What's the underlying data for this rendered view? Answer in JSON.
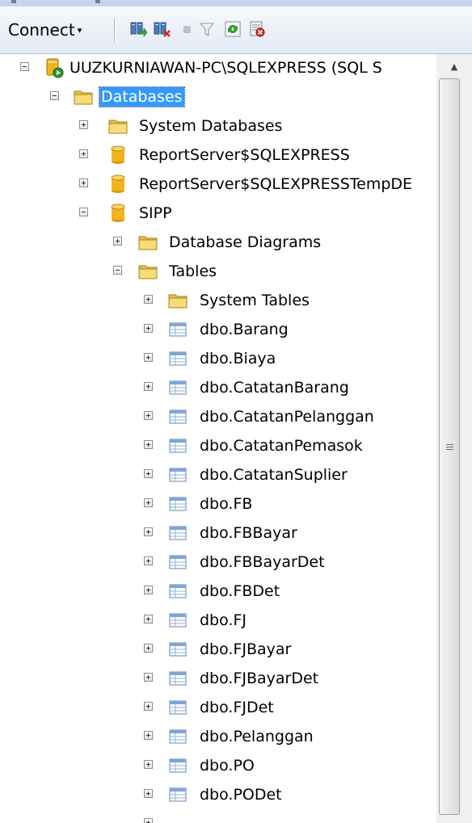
{
  "toolbar": {
    "connect_label": "Connect",
    "connect_arrow": "▾",
    "icons": [
      "register-server-icon",
      "disconnect-icon",
      "stop-icon",
      "filter-icon",
      "refresh-icon",
      "activity-monitor-icon"
    ]
  },
  "tree": {
    "server": "UUZKURNIAWAN-PC\\SQLEXPRESS (SQL S",
    "databases": "Databases",
    "system_databases": "System Databases",
    "db_reportserver": "ReportServer$SQLEXPRESS",
    "db_reportserver_temp": "ReportServer$SQLEXPRESSTempDE",
    "db_sipp": "SIPP",
    "database_diagrams": "Database Diagrams",
    "tables": "Tables",
    "system_tables": "System Tables",
    "table_items": [
      "dbo.Barang",
      "dbo.Biaya",
      "dbo.CatatanBarang",
      "dbo.CatatanPelanggan",
      "dbo.CatatanPemasok",
      "dbo.CatatanSuplier",
      "dbo.FB",
      "dbo.FBBayar",
      "dbo.FBBayarDet",
      "dbo.FBDet",
      "dbo.FJ",
      "dbo.FJBayar",
      "dbo.FJBayarDet",
      "dbo.FJDet",
      "dbo.Pelanggan",
      "dbo.PO",
      "dbo.PODet"
    ]
  },
  "colors": {
    "selection": "#3399ff",
    "folder": "#e8c04a",
    "database": "#f2b41e"
  }
}
